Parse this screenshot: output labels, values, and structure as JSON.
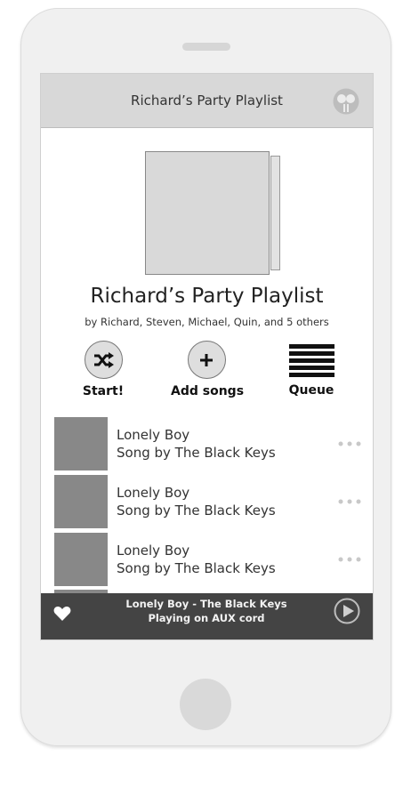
{
  "header": {
    "title": "Richard’s Party Playlist",
    "avatar_icon": "face-avatar-icon"
  },
  "playlist": {
    "title": "Richard’s Party Playlist",
    "contributors": "by Richard, Steven, Michael, Quin, and 5 others"
  },
  "actions": [
    {
      "label": "Start!",
      "icon": "shuffle-icon"
    },
    {
      "label": "Add songs",
      "icon": "plus-icon"
    },
    {
      "label": "Queue",
      "icon": "queue-list-icon"
    }
  ],
  "songs": [
    {
      "title": "Lonely Boy",
      "artist": "Song by The Black Keys"
    },
    {
      "title": "Lonely Boy",
      "artist": "Song by The Black Keys"
    },
    {
      "title": "Lonely Boy",
      "artist": "Song by The Black Keys"
    }
  ],
  "now_playing": {
    "title": "Lonely Boy - The Black Keys",
    "status": "Playing on AUX cord",
    "like_icon": "heart-icon",
    "play_icon": "play-icon"
  },
  "colors": {
    "header_bg": "#d8d8d8",
    "player_bg": "#444444",
    "thumb": "#888888",
    "phone_body": "#f0f0f0"
  }
}
